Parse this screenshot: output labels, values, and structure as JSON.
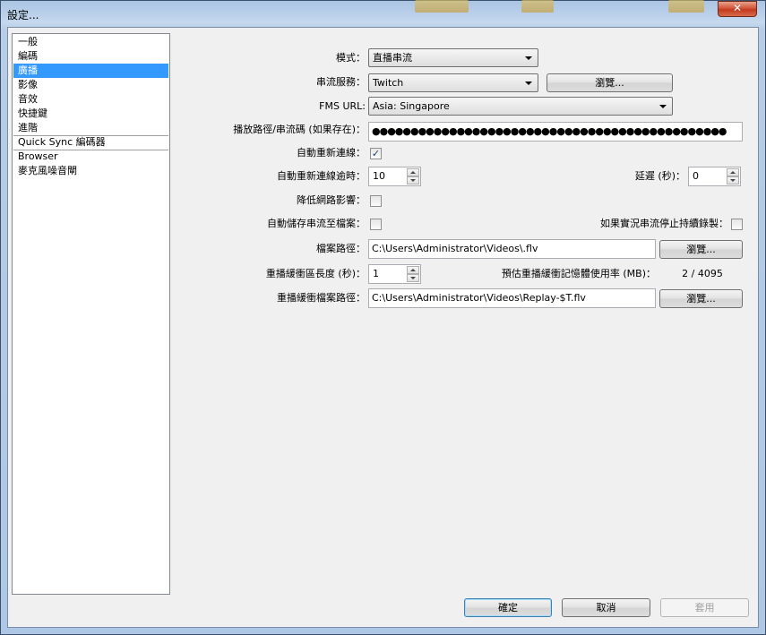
{
  "window": {
    "title": "設定...",
    "close_glyph": "✕"
  },
  "sidebar": {
    "items": [
      {
        "label": "一般"
      },
      {
        "label": "編碼"
      },
      {
        "label": "廣播",
        "selected": true
      },
      {
        "label": "影像"
      },
      {
        "label": "音效"
      },
      {
        "label": "快捷鍵"
      },
      {
        "label": "進階"
      },
      {
        "label": "Quick Sync 編碼器"
      },
      {
        "label": "Browser"
      },
      {
        "label": "麥克風噪音閘"
      }
    ]
  },
  "form": {
    "mode": {
      "label": "模式：",
      "value": "直播串流"
    },
    "service": {
      "label": "串流服務：",
      "value": "Twitch",
      "browse": "瀏覽..."
    },
    "fms_url": {
      "label": "FMS URL:",
      "value": "Asia: Singapore"
    },
    "stream_key": {
      "label": "播放路徑/串流碼 (如果存在)：",
      "value": "●●●●●●●●●●●●●●●●●●●●●●●●●●●●●●●●●●●●●●●●●●●●●●"
    },
    "auto_reconnect": {
      "label": "自動重新連線：",
      "checked": true
    },
    "reconnect_timeout": {
      "label": "自動重新連線逾時：",
      "value": "10"
    },
    "delay": {
      "label": "延遲 (秒)：",
      "value": "0"
    },
    "minimize_network": {
      "label": "降低網路影響：",
      "checked": false
    },
    "autosave": {
      "label": "自動儲存串流至檔案：",
      "checked": false
    },
    "keep_recording": {
      "label": "如果實況串流停止持續錄製：",
      "checked": false
    },
    "file_path": {
      "label": "檔案路徑：",
      "value": "C:\\Users\\Administrator\\Videos\\.flv",
      "browse": "瀏覽..."
    },
    "replay_buffer": {
      "label": "重播緩衝區長度 (秒)：",
      "value": "1"
    },
    "memory_usage": {
      "label": "預估重播緩衝記憶體使用率 (MB)：",
      "value": "2 / 4095"
    },
    "replay_path": {
      "label": "重播緩衝檔案路徑：",
      "value": "C:\\Users\\Administrator\\Videos\\Replay-$T.flv",
      "browse": "瀏覽..."
    }
  },
  "buttons": {
    "ok": "確定",
    "cancel": "取消",
    "apply": "套用"
  },
  "colors": {
    "selection": "#3399ff",
    "frame": "#aec7e4",
    "client": "#f0f0f0"
  }
}
